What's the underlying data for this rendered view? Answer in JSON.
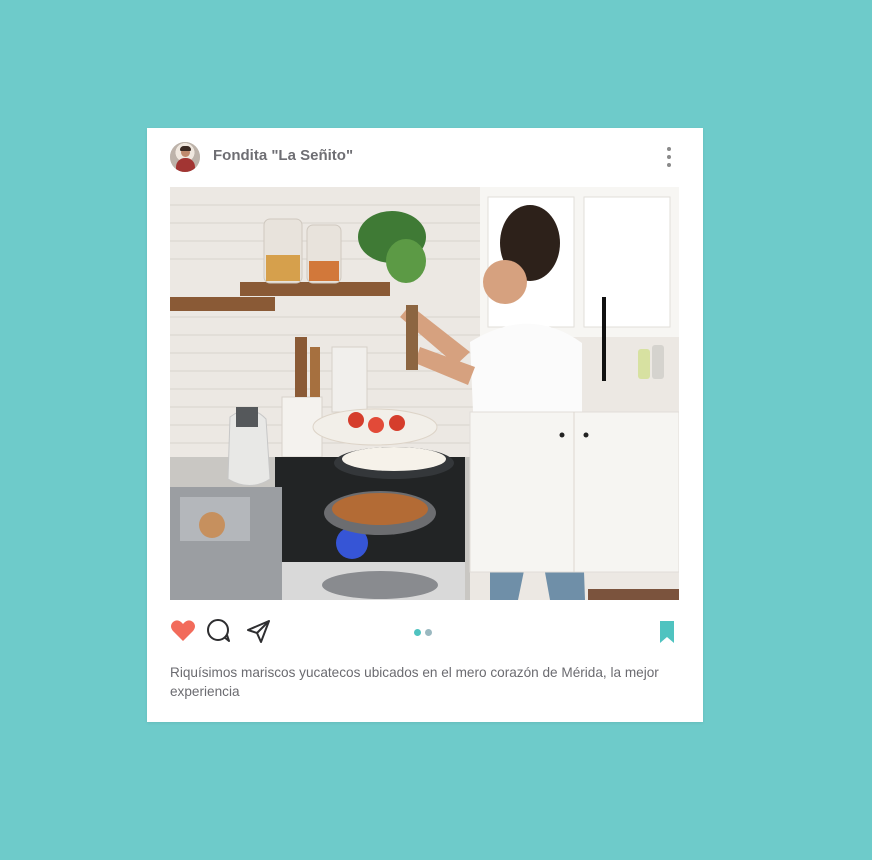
{
  "post": {
    "username": "Fondita \"La Señito\"",
    "caption": "Riquísimos mariscos yucatecos ubicados en el mero corazón de Mérida, la mejor experiencia"
  },
  "icons": {
    "avatar": "profile-avatar",
    "more": "more-vertical-icon",
    "like": "heart-icon",
    "comment": "comment-icon",
    "share": "send-icon",
    "save": "bookmark-icon"
  },
  "carousel": {
    "total": 2,
    "active_index": 0
  },
  "colors": {
    "background": "#6ecbca",
    "card": "#ffffff",
    "like": "#f26b5b",
    "accent": "#4fc3c0",
    "dot_inactive": "#9ab8c0",
    "text": "#6b6b70"
  }
}
